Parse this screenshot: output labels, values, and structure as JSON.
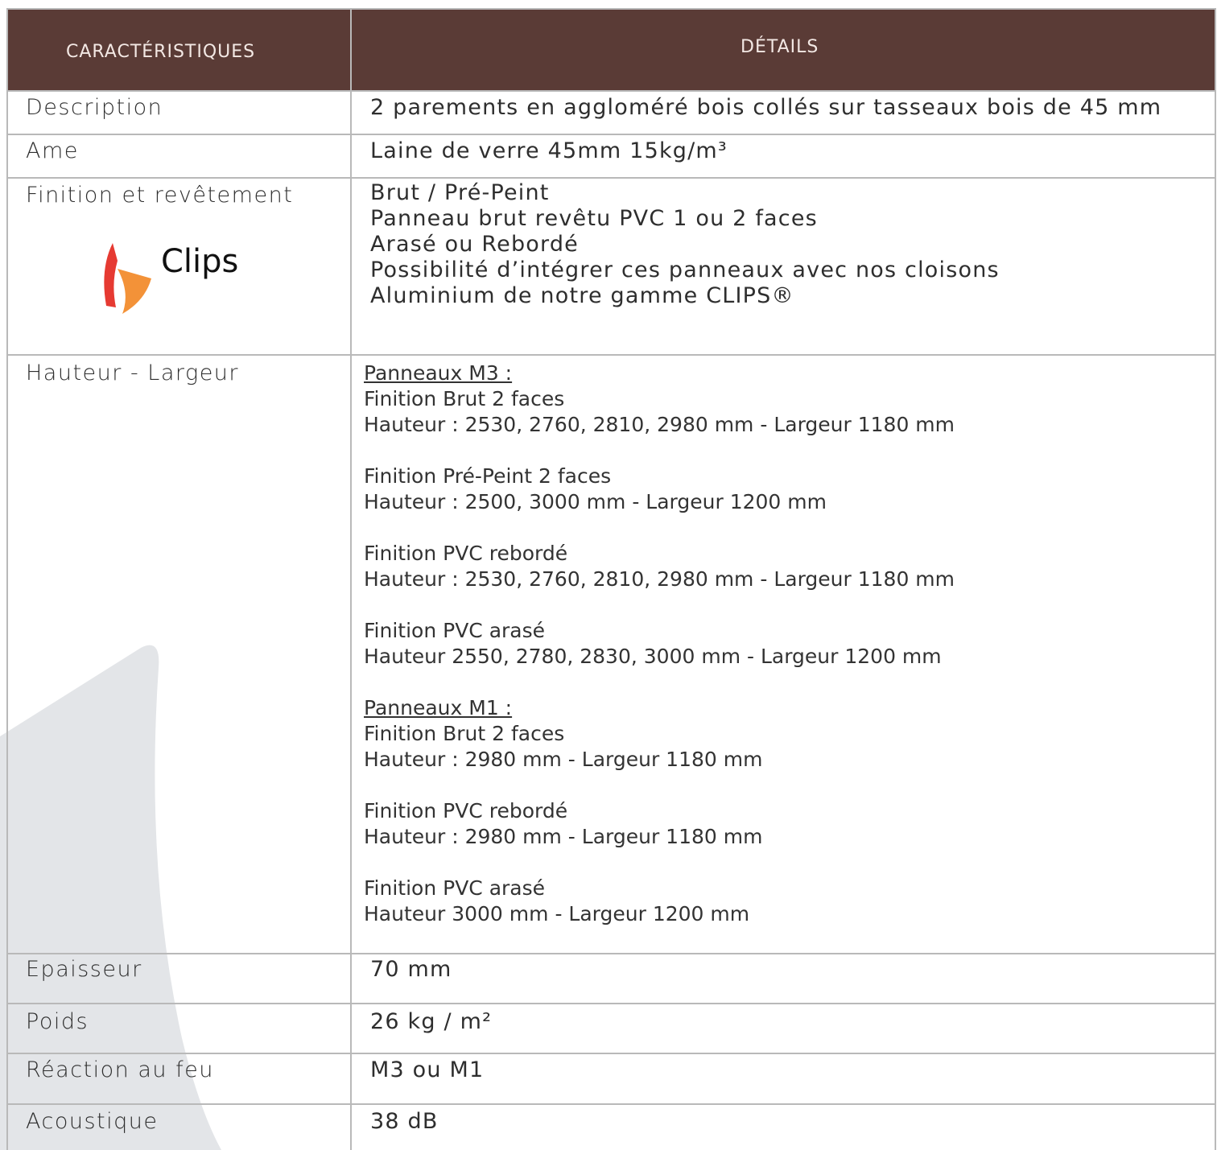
{
  "header": {
    "col1": "CARACTÉRISTIQUES",
    "col2": "DÉTAILS"
  },
  "rows": {
    "description": {
      "label": "Description",
      "value": "2 parements en aggloméré bois collés sur tasseaux bois de 45 mm"
    },
    "ame": {
      "label": "Ame",
      "value": "Laine de verre 45mm 15kg/m³"
    },
    "finition": {
      "label": "Finition et revêtement",
      "lines": [
        "Brut / Pré-Peint",
        "Panneau brut revêtu PVC 1 ou 2 faces",
        "Arasé ou Rebordé",
        "Possibilité d’intégrer ces panneaux avec nos cloisons",
        "Aluminium de notre gamme CLIPS®"
      ],
      "logo_text": "Clips"
    },
    "dimensions": {
      "label": "Hauteur - Largeur",
      "m3_title": "Panneaux M3 :",
      "m3": [
        {
          "title": "Finition Brut 2 faces",
          "detail": "Hauteur : 2530, 2760, 2810, 2980 mm - Largeur 1180 mm"
        },
        {
          "title": "Finition Pré-Peint 2 faces",
          "detail": "Hauteur : 2500, 3000 mm - Largeur 1200 mm"
        },
        {
          "title": "Finition PVC rebordé",
          "detail": "Hauteur : 2530, 2760, 2810, 2980 mm - Largeur 1180 mm"
        },
        {
          "title": "Finition PVC arasé",
          "detail": "Hauteur 2550, 2780, 2830, 3000 mm - Largeur 1200 mm"
        }
      ],
      "m1_title": "Panneaux M1 :",
      "m1": [
        {
          "title": "Finition Brut 2 faces",
          "detail": "Hauteur : 2980 mm - Largeur 1180 mm"
        },
        {
          "title": "Finition PVC rebordé",
          "detail": "Hauteur : 2980 mm - Largeur 1180 mm"
        },
        {
          "title": "Finition PVC arasé",
          "detail": "Hauteur 3000 mm - Largeur 1200 mm"
        }
      ]
    },
    "epaisseur": {
      "label": "Epaisseur",
      "value": "70 mm"
    },
    "poids": {
      "label": "Poids",
      "value": "26 kg / m²"
    },
    "feu": {
      "label": "Réaction au feu",
      "value": "M3 ou M1"
    },
    "acoustique": {
      "label": "Acoustique",
      "value": "38 dB"
    }
  },
  "colors": {
    "header_bg": "#5a3b36",
    "header_text": "#f3e8e4",
    "grid": "#b9b9b9",
    "shape": "#e3e5e8",
    "logo_red": "#e63a32",
    "logo_orange": "#f39238"
  }
}
